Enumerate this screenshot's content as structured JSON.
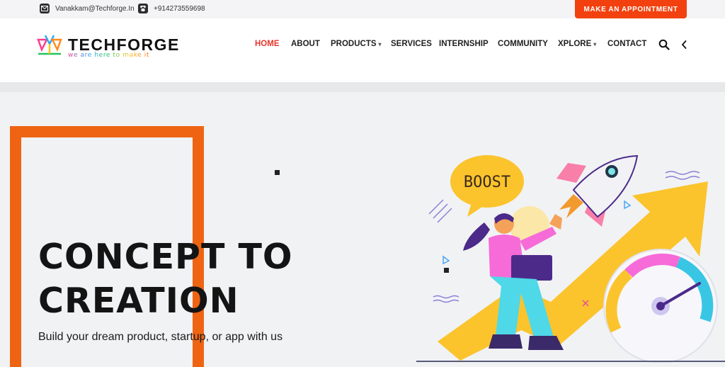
{
  "topbar": {
    "email": "Vanakkam@Techforge.In",
    "phone": "+914273559698",
    "appointment_label": "MAKE AN APPOINTMENT",
    "email_icon": "envelope-icon",
    "phone_icon": "phone-icon"
  },
  "brand": {
    "name": "TECHFORGE",
    "tagline": "we are here to make it"
  },
  "nav": [
    {
      "label": "HOME",
      "active": true
    },
    {
      "label": "ABOUT"
    },
    {
      "label": "PRODUCTS",
      "dropdown": true
    },
    {
      "label": "SERVICES"
    },
    {
      "label": "INTERNSHIP"
    },
    {
      "label": "COMMUNITY"
    },
    {
      "label": "XPLORE",
      "dropdown": true
    },
    {
      "label": "CONTACT"
    }
  ],
  "header_icons": [
    "search-icon",
    "chevron-left-icon"
  ],
  "hero": {
    "title_line1": "CONCEPT TO",
    "title_line2": "CREATION",
    "subtitle": "Build your dream product, startup, or app with us",
    "bubble_text": "BOOST"
  },
  "colors": {
    "accent": "#f2410f",
    "frame": "#ee6413",
    "nav_active": "#e8362b",
    "arrow": "#fbc42d",
    "pink": "#f66bd8",
    "purple": "#4b2a8a"
  }
}
